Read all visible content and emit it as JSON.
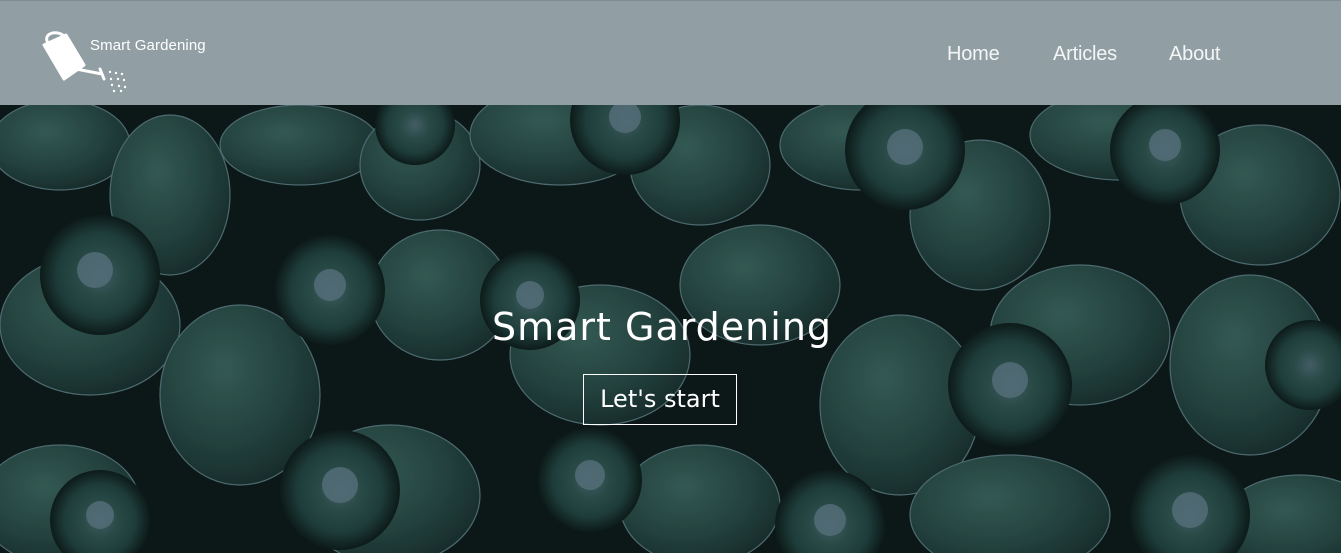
{
  "header": {
    "background_color": "#919fa4",
    "logo": {
      "text": "Smart Gardening",
      "icon": "watering-can-icon"
    },
    "nav": {
      "items": [
        {
          "label": "Home"
        },
        {
          "label": "Articles"
        },
        {
          "label": "About"
        }
      ]
    }
  },
  "hero": {
    "background_image": "succulent-leaves-photo",
    "title": "Smart Gardening",
    "button_label": "Let's start"
  }
}
